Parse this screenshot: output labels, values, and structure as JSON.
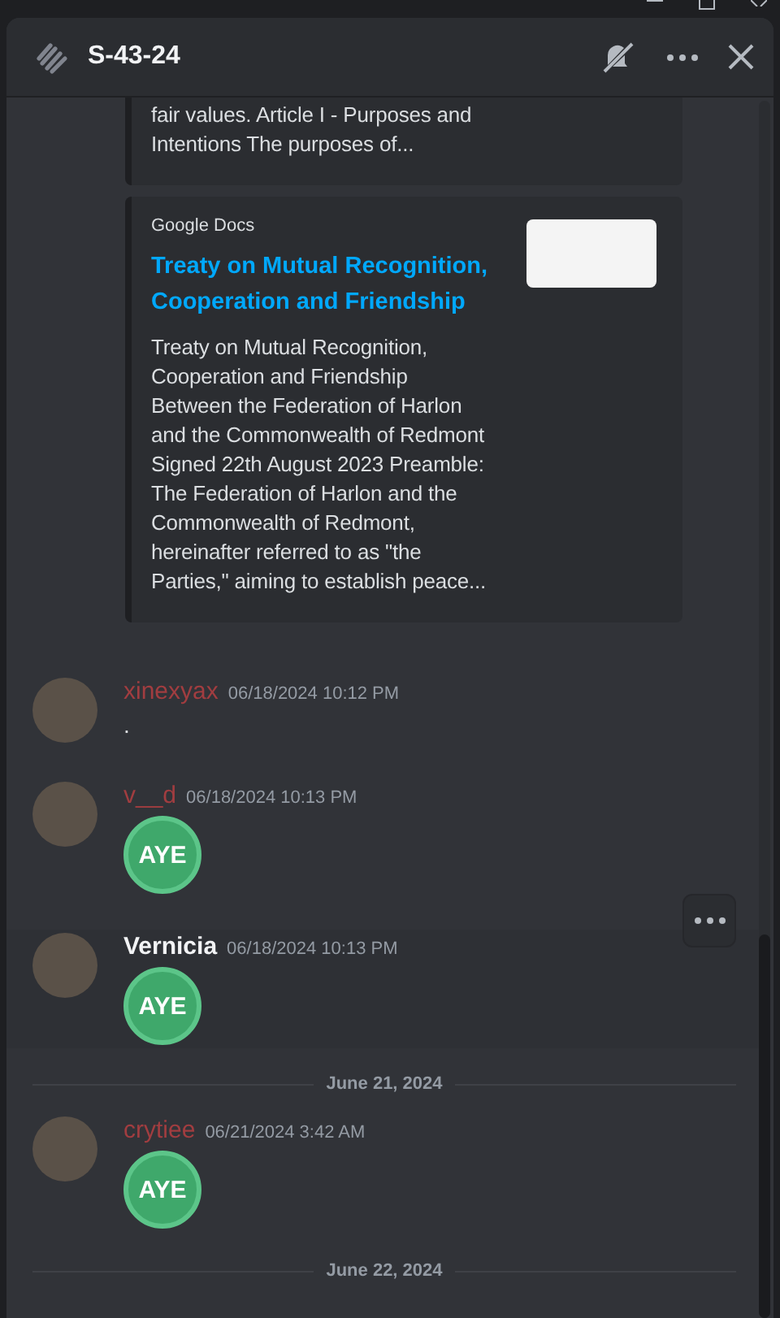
{
  "header": {
    "title": "S-43-24"
  },
  "embeds": [
    {
      "description_lines": [
        "fair values. Article I - Purposes and",
        "Intentions The purposes of..."
      ]
    },
    {
      "provider": "Google Docs",
      "title": "Treaty on Mutual Recognition, Cooperation and Friendship",
      "description_lines": [
        "Treaty on Mutual Recognition,",
        "Cooperation and Friendship",
        "Between the Federation of Harlon",
        "and the Commonwealth of Redmont",
        "Signed 22th August 2023 Preamble:",
        "The Federation of Harlon and the",
        "Commonwealth of Redmont,",
        "hereinafter referred to as \"the",
        "Parties,\" aiming to establish peace..."
      ],
      "thumbnail": true
    }
  ],
  "feed": [
    {
      "kind": "message",
      "author": "xinexyax",
      "color": "#a13d40",
      "timestamp": "06/18/2024 10:12 PM",
      "text": "."
    },
    {
      "kind": "message",
      "author": "v__d",
      "color": "#a13d40",
      "timestamp": "06/18/2024 10:13 PM",
      "emoji": "AYE"
    },
    {
      "kind": "message",
      "author": "Vernicia",
      "color": "#f2f3f5",
      "timestamp": "06/18/2024 10:13 PM",
      "emoji": "AYE",
      "hovered": true
    },
    {
      "kind": "divider",
      "label": "June 21, 2024"
    },
    {
      "kind": "message",
      "author": "crytiee",
      "color": "#a13d40",
      "timestamp": "06/21/2024 3:42 AM",
      "emoji": "AYE"
    },
    {
      "kind": "divider",
      "label": "June 22, 2024"
    }
  ]
}
